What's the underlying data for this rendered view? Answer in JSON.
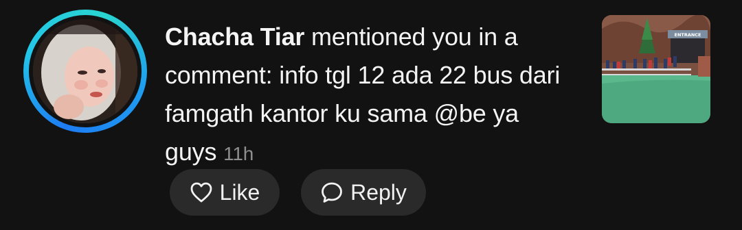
{
  "notification": {
    "username": "Chacha Tiar",
    "message": " mentioned you in a comment: info tgl 12 ada 22 bus dari famgath kantor ku sama @be ya guys",
    "timestamp": "11h",
    "avatar_icon": "profile-photo",
    "story_ring_colors": [
      "#1e7cf2",
      "#22c7e8",
      "#2ad4d0"
    ],
    "thumbnail_sign_text": "ENTRANCE"
  },
  "actions": {
    "like_label": "Like",
    "like_icon": "heart-outline-icon",
    "reply_label": "Reply",
    "reply_icon": "speech-bubble-outline-icon"
  }
}
